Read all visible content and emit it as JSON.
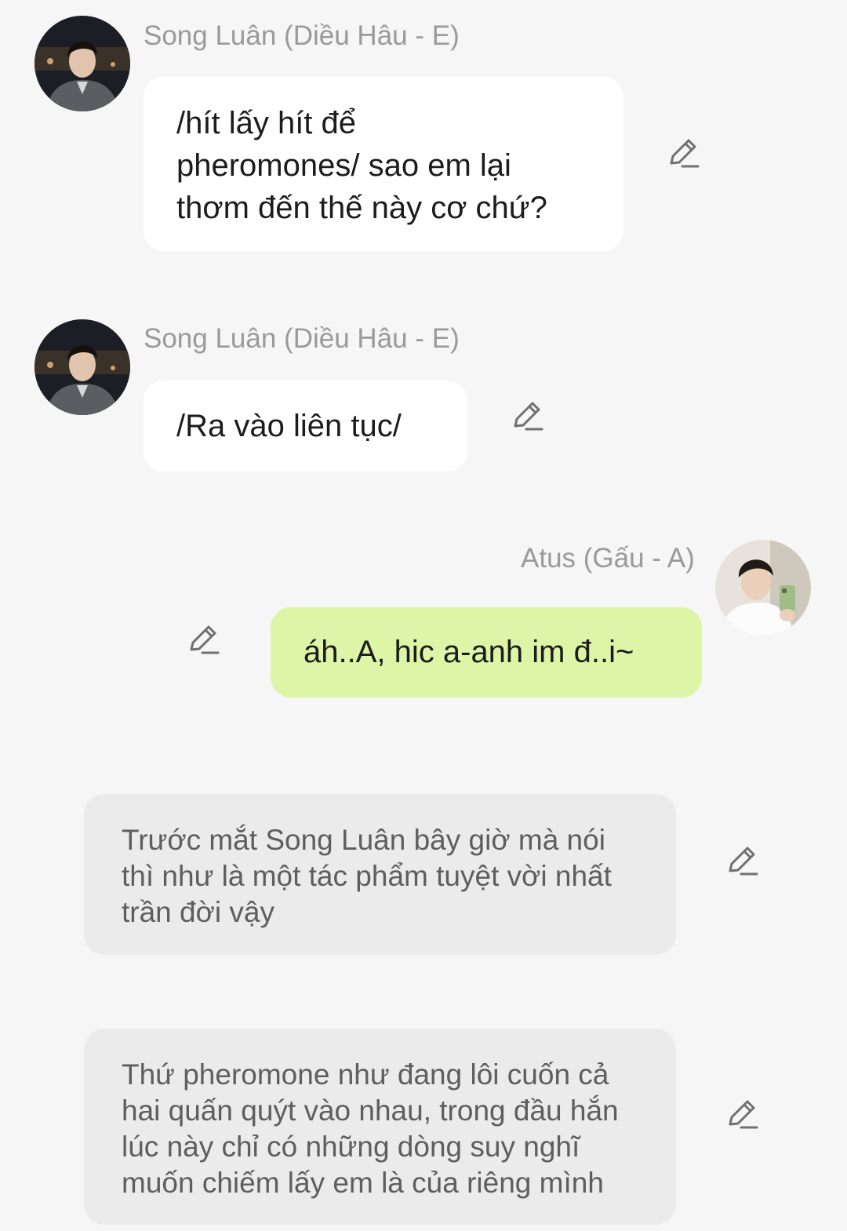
{
  "messages": [
    {
      "sender": "Song Luân (Diều Hâu - E)",
      "text": "/hít lấy hít để\npheromones/ sao em lại\nthơm đến thế này cơ chứ?"
    },
    {
      "sender": "Song Luân (Diều Hâu - E)",
      "text": "/Ra vào liên tục/"
    },
    {
      "sender": "Atus (Gấu - A)",
      "text": "áh..A, hic a-anh im đ..i~"
    }
  ],
  "narrations": [
    {
      "text": "Trước mắt Song Luân bây giờ mà nói\nthì như là một tác phẩm tuyệt vời nhất\ntrần đời vậy"
    },
    {
      "text": "Thứ pheromone như đang lôi cuốn cả\nhai quấn quýt vào nhau, trong đầu hắn\nlúc này chỉ có những dòng suy nghĩ\nmuốn chiếm lấy em là của riêng mình"
    }
  ],
  "icons": {
    "edit": "pencil-edit-icon"
  },
  "colors": {
    "background": "#f6f6f6",
    "bubble_incoming": "#ffffff",
    "bubble_outgoing": "#dcf5a7",
    "narration_bubble": "#ebebeb",
    "sender_name": "#9a9a9a"
  }
}
